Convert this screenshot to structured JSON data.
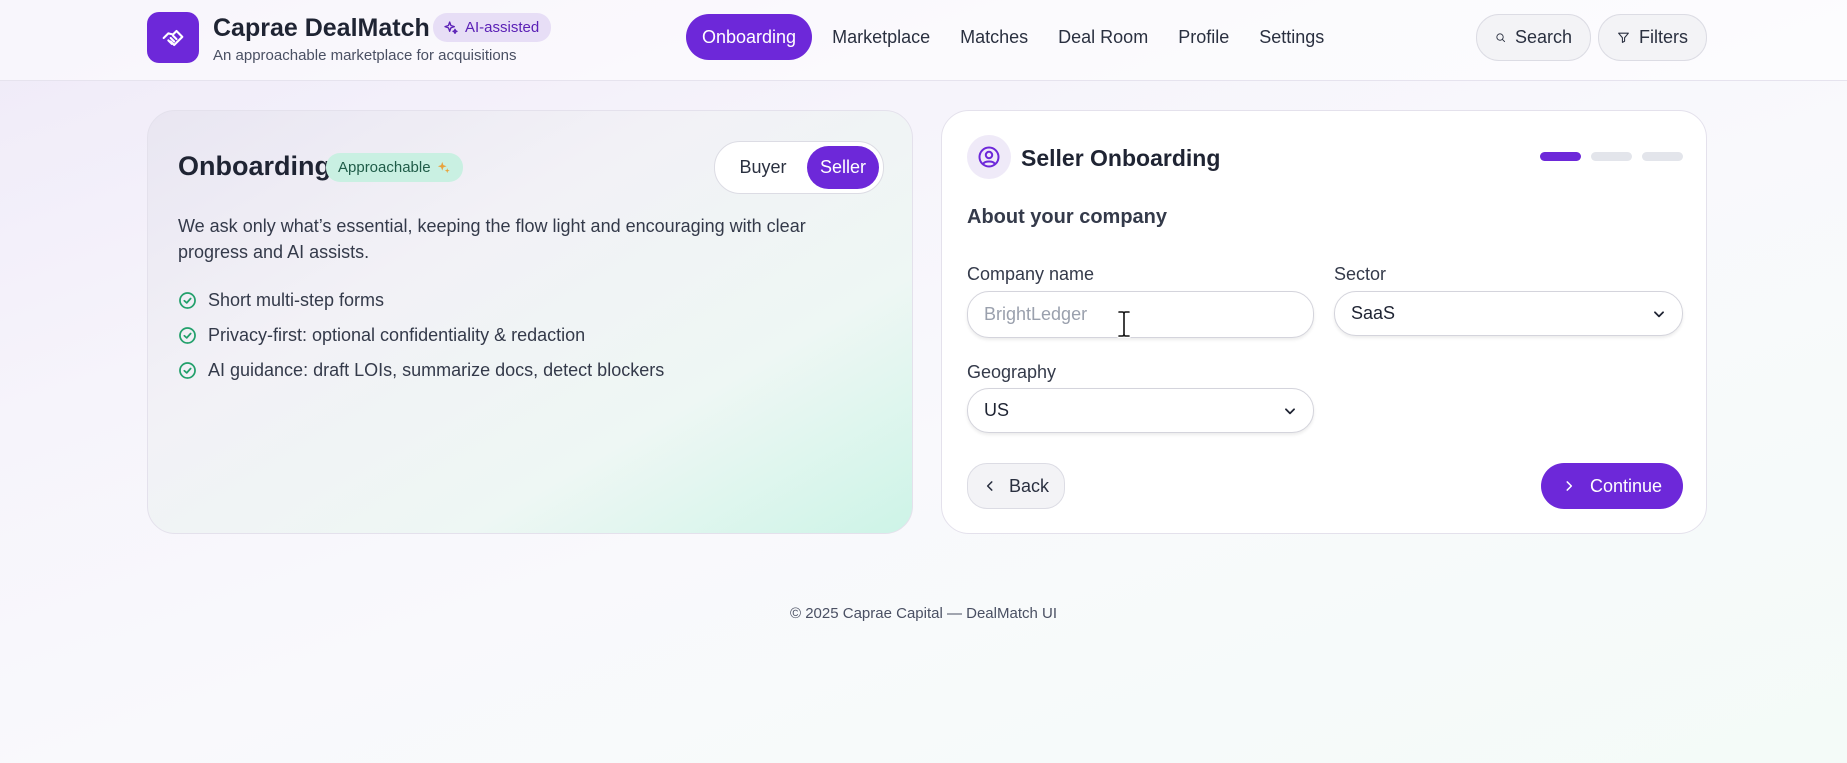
{
  "header": {
    "brand_title": "Caprae DealMatch",
    "brand_subtitle": "An approachable marketplace for acquisitions",
    "ai_badge": "AI-assisted",
    "nav": [
      {
        "label": "Onboarding",
        "active": true
      },
      {
        "label": "Marketplace",
        "active": false
      },
      {
        "label": "Matches",
        "active": false
      },
      {
        "label": "Deal Room",
        "active": false
      },
      {
        "label": "Profile",
        "active": false
      },
      {
        "label": "Settings",
        "active": false
      }
    ],
    "search_label": "Search",
    "filters_label": "Filters"
  },
  "onboarding_intro": {
    "title": "Onboarding",
    "badge": "Approachable",
    "badge_icon": "sparkles-icon",
    "role_options": [
      "Buyer",
      "Seller"
    ],
    "selected_role": "Seller",
    "description": "We ask only what’s essential, keeping the flow light and encouraging with clear progress and AI assists.",
    "bullets": [
      "Short multi-step forms",
      "Privacy-first: optional confidentiality & redaction",
      "AI guidance: draft LOIs, summarize docs, detect blockers"
    ]
  },
  "seller_form": {
    "title": "Seller Onboarding",
    "step_current": 1,
    "step_total": 3,
    "section": "About your company",
    "company_name_label": "Company name",
    "company_name_placeholder": "BrightLedger",
    "company_name_value": "",
    "sector_label": "Sector",
    "sector_value": "SaaS",
    "geography_label": "Geography",
    "geography_value": "US",
    "back_label": "Back",
    "continue_label": "Continue"
  },
  "footer": {
    "text": "© 2025 Caprae Capital — DealMatch UI"
  },
  "colors": {
    "accent": "#6d28d9",
    "success": "#22a06b",
    "badge_green_bg": "#c9f0e2"
  }
}
